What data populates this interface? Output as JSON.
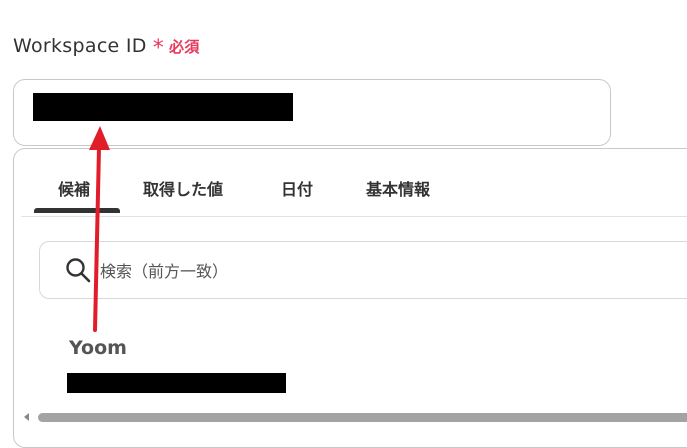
{
  "field": {
    "label": "Workspace ID",
    "required_star": "*",
    "required_text": "必須"
  },
  "tabs": [
    {
      "label": "候補",
      "active": true
    },
    {
      "label": "取得した値",
      "active": false
    },
    {
      "label": "日付",
      "active": false
    },
    {
      "label": "基本情報",
      "active": false
    }
  ],
  "search": {
    "placeholder": "検索（前方一致）"
  },
  "candidates": [
    {
      "name": "Yoom"
    }
  ],
  "colors": {
    "required": "#e8395b",
    "arrow": "#e11d2a",
    "redaction": "#000000"
  },
  "icons": {
    "search": "search-icon",
    "scroll_left": "chevron-left-icon"
  }
}
